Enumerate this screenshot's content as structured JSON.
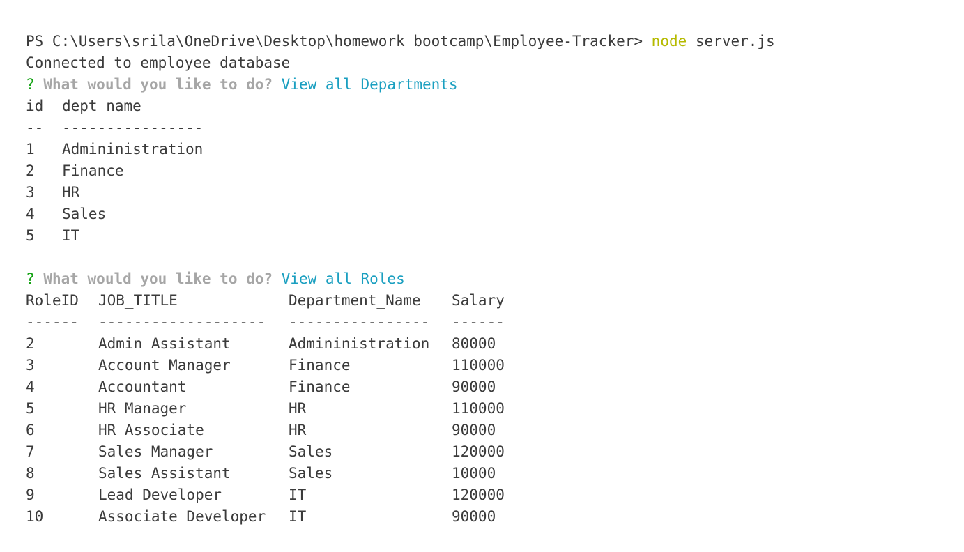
{
  "prompt": {
    "path": "PS C:\\Users\\srila\\OneDrive\\Desktop\\homework_bootcamp\\Employee-Tracker>",
    "cmd": "node",
    "args": "server.js"
  },
  "connected_message": "Connected to employee database",
  "question1": {
    "mark": "?",
    "text": "What would you like to do?",
    "answer": "View all Departments"
  },
  "departments": {
    "headers": [
      "id",
      "dept_name"
    ],
    "separators": [
      "--",
      "----------------"
    ],
    "rows": [
      [
        "1",
        "Admininistration"
      ],
      [
        "2",
        "Finance"
      ],
      [
        "3",
        "HR"
      ],
      [
        "4",
        "Sales"
      ],
      [
        "5",
        "IT"
      ]
    ]
  },
  "question2": {
    "mark": "?",
    "text": "What would you like to do?",
    "answer": "View all Roles"
  },
  "roles": {
    "headers": [
      "RoleID",
      "JOB_TITLE",
      "Department_Name",
      "Salary"
    ],
    "separators": [
      "------",
      "-------------------",
      "----------------",
      "------"
    ],
    "rows": [
      [
        "2",
        "Admin Assistant",
        "Admininistration",
        "80000"
      ],
      [
        "3",
        "Account Manager",
        "Finance",
        "110000"
      ],
      [
        "4",
        "Accountant",
        "Finance",
        "90000"
      ],
      [
        "5",
        "HR Manager",
        "HR",
        "110000"
      ],
      [
        "6",
        "HR Associate",
        "HR",
        "90000"
      ],
      [
        "7",
        "Sales Manager",
        "Sales",
        "120000"
      ],
      [
        "8",
        "Sales Assistant",
        "Sales",
        "10000"
      ],
      [
        "9",
        "Lead Developer",
        "IT",
        "120000"
      ],
      [
        "10",
        "Associate Developer",
        "IT",
        "90000"
      ]
    ]
  },
  "colors": {
    "text": "#3b3b3b",
    "command": "#b5ba00",
    "question_mark": "#14a314",
    "question_text": "#a6a6a6",
    "answer": "#1a9fc0",
    "background": "#ffffff"
  }
}
